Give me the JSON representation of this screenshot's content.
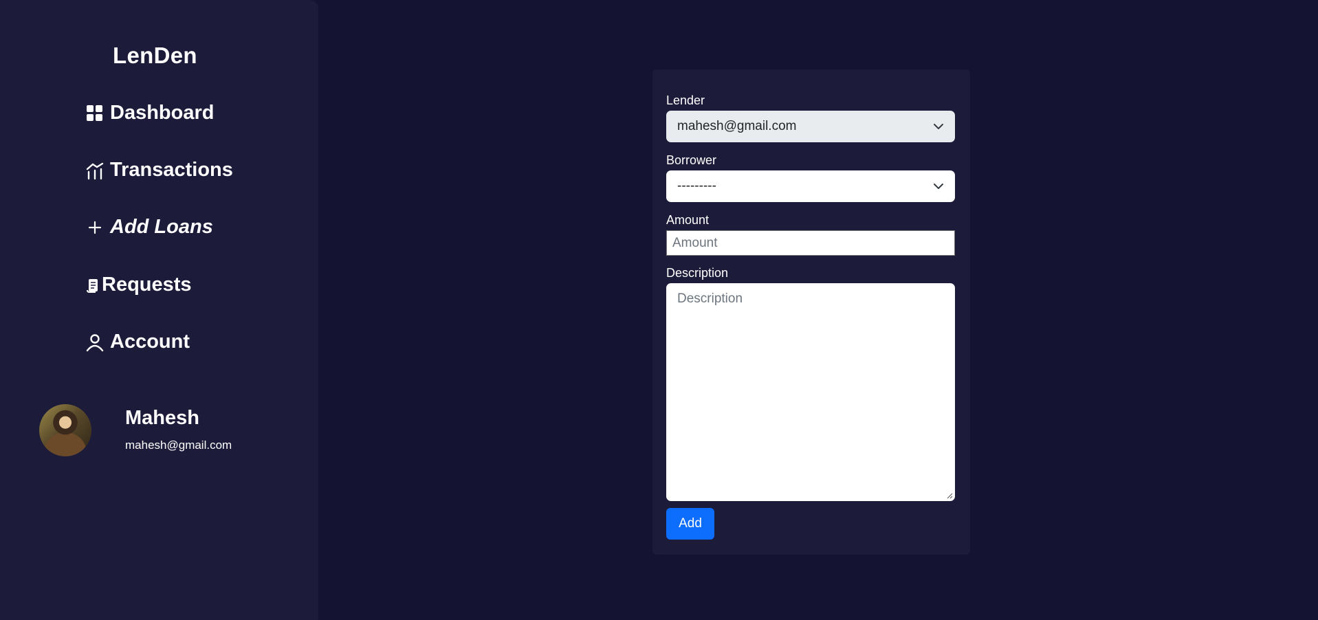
{
  "sidebar": {
    "brand": "LenDen",
    "items": [
      {
        "label": "Dashboard",
        "icon": "grid-icon"
      },
      {
        "label": "Transactions",
        "icon": "chart-icon"
      },
      {
        "label": "Add Loans",
        "icon": "plus-icon"
      },
      {
        "label": "Requests",
        "icon": "document-icon"
      },
      {
        "label": "Account",
        "icon": "user-icon"
      }
    ],
    "active_item": "Add Loans"
  },
  "profile": {
    "name": "Mahesh",
    "email": "mahesh@gmail.com"
  },
  "form": {
    "lender_label": "Lender",
    "lender_value": "mahesh@gmail.com",
    "borrower_label": "Borrower",
    "borrower_value": "---------",
    "amount_label": "Amount",
    "amount_placeholder": "Amount",
    "description_label": "Description",
    "description_placeholder": "Description",
    "submit_label": "Add"
  },
  "colors": {
    "background": "#141432",
    "panel": "#1c1b3a",
    "primary_button": "#0d6efd"
  }
}
